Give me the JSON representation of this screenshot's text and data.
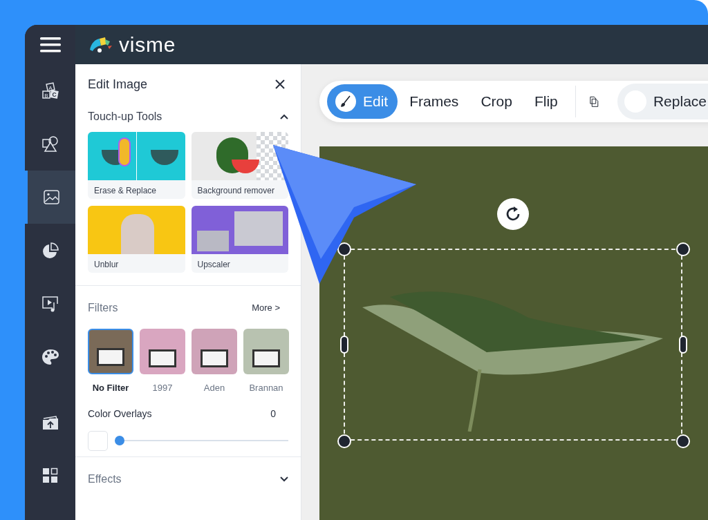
{
  "topbar": {
    "logo_text": "visme"
  },
  "sidebar": {
    "items": [
      {
        "kind": "blocks",
        "selected": false,
        "letters": [
          "A",
          "B",
          "C"
        ]
      },
      {
        "kind": "shapes",
        "selected": false
      },
      {
        "kind": "image",
        "selected": true
      },
      {
        "kind": "chart",
        "selected": false
      },
      {
        "kind": "media",
        "selected": false
      },
      {
        "kind": "palette",
        "selected": false
      },
      {
        "kind": "upload",
        "selected": false
      },
      {
        "kind": "apps",
        "selected": false
      }
    ]
  },
  "panel": {
    "title": "Edit Image",
    "touchup": {
      "title": "Touch-up Tools",
      "expanded": true,
      "tools": [
        {
          "label": "Erase & Replace",
          "kind": "erase"
        },
        {
          "label": "Background remover",
          "kind": "bgremove"
        },
        {
          "label": "Unblur",
          "kind": "unblur"
        },
        {
          "label": "Upscaler",
          "kind": "upscale"
        }
      ]
    },
    "filters": {
      "title": "Filters",
      "more": "More >",
      "items": [
        {
          "label": "No Filter",
          "selected": true,
          "color": "#7a6a58"
        },
        {
          "label": "1997",
          "selected": false,
          "color": "#d9a6c0"
        },
        {
          "label": "Aden",
          "selected": false,
          "color": "#cfa3b8"
        },
        {
          "label": "Brannan",
          "selected": false,
          "color": "#b8c2b0"
        }
      ]
    },
    "overlays": {
      "title": "Color Overlays",
      "reading": "0",
      "level": 0
    },
    "effects": {
      "title": "Effects",
      "expanded": false
    }
  },
  "toolbar": {
    "tabs": [
      {
        "label": "Edit",
        "selected": true
      },
      {
        "label": "Frames",
        "selected": false
      },
      {
        "label": "Crop",
        "selected": false
      },
      {
        "label": "Flip",
        "selected": false
      }
    ],
    "replace": "Replace"
  }
}
